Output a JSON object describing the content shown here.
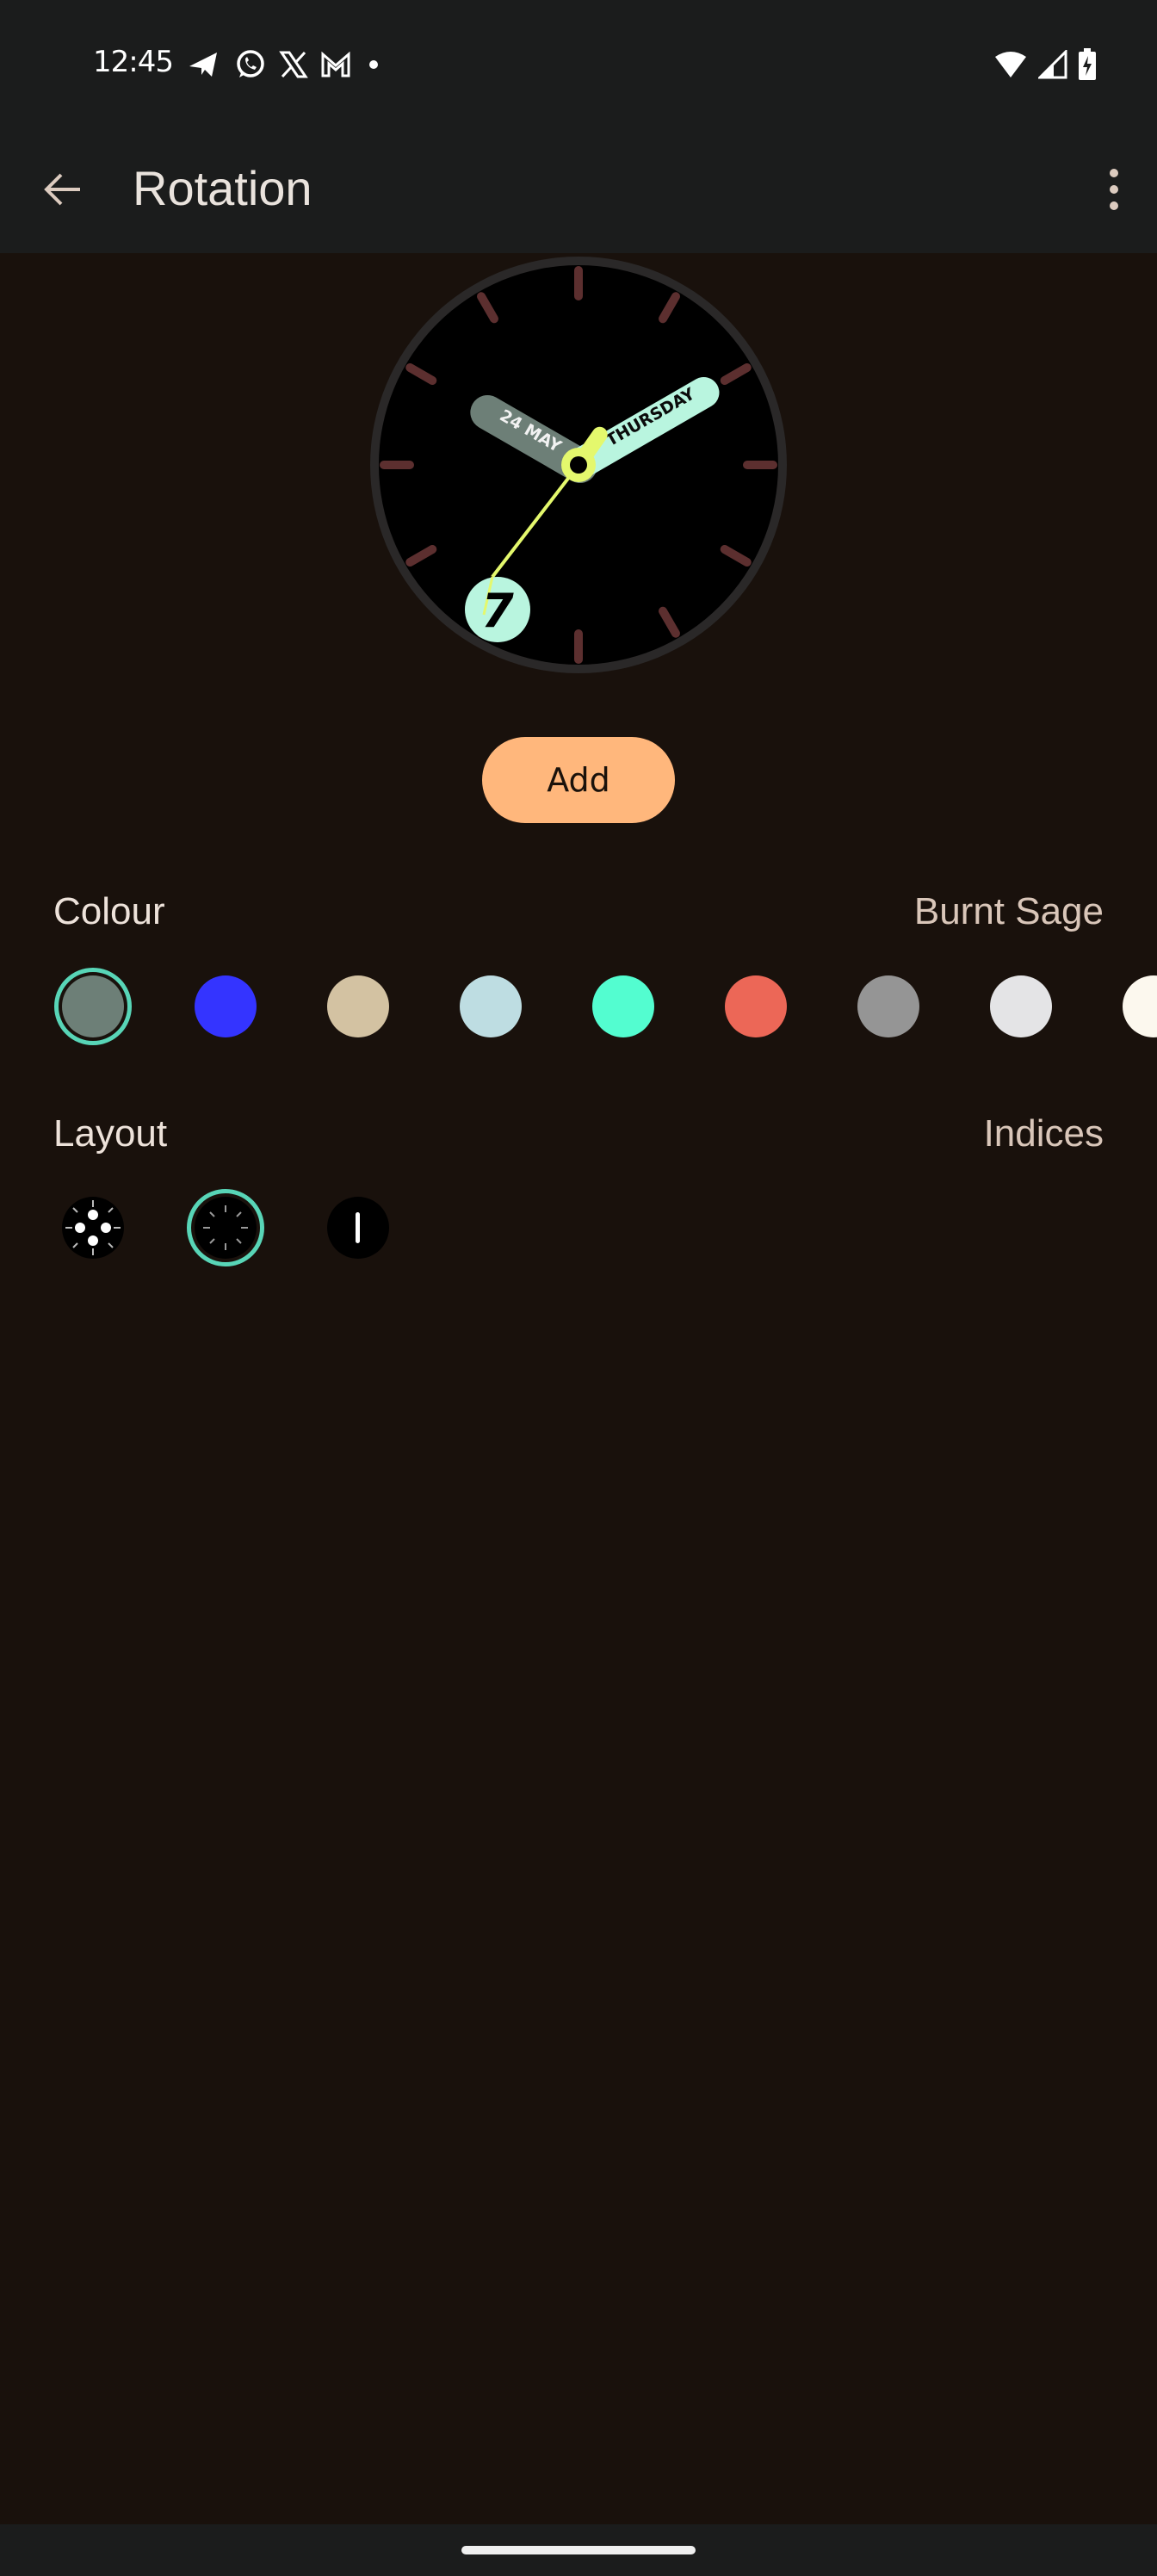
{
  "status_bar": {
    "time": "12:45",
    "notification_icons": [
      "telegram-icon",
      "whatsapp-icon",
      "x-icon",
      "gmail-icon",
      "more-dot-icon"
    ],
    "system_icons": [
      "wifi-icon",
      "signal-icon",
      "battery-charging-icon"
    ]
  },
  "app_bar": {
    "title": "Rotation",
    "back_icon": "arrow-back-icon",
    "menu_icon": "more-vert-icon"
  },
  "preview": {
    "date_label": "24 MAY",
    "day_label": "THURSDAY",
    "seconds_badge": "7",
    "colors": {
      "ticks": "#5c2f2f",
      "date_hand": "#6d7f77",
      "day_hand": "#b9f5df",
      "accent": "#e4f86d",
      "bezel": "#2a2828"
    }
  },
  "add_button": {
    "label": "Add"
  },
  "colour": {
    "label": "Colour",
    "selected_name": "Burnt Sage",
    "selection_color": "#58d5b7",
    "swatches": [
      {
        "color": "#6d7f77",
        "selected": true
      },
      {
        "color": "#3434ff",
        "selected": false
      },
      {
        "color": "#d3c2a2",
        "selected": false
      },
      {
        "color": "#bedde2",
        "selected": false
      },
      {
        "color": "#53fdd0",
        "selected": false
      },
      {
        "color": "#ec6757",
        "selected": false
      },
      {
        "color": "#959595",
        "selected": false
      },
      {
        "color": "#e4e4e6",
        "selected": false
      },
      {
        "color": "#fcf8ee",
        "selected": false
      }
    ]
  },
  "layout": {
    "label": "Layout",
    "selected_name": "Indices",
    "options": [
      {
        "name": "dots-and-ticks",
        "selected": false
      },
      {
        "name": "indices",
        "selected": true
      },
      {
        "name": "single-bar",
        "selected": false
      }
    ]
  }
}
